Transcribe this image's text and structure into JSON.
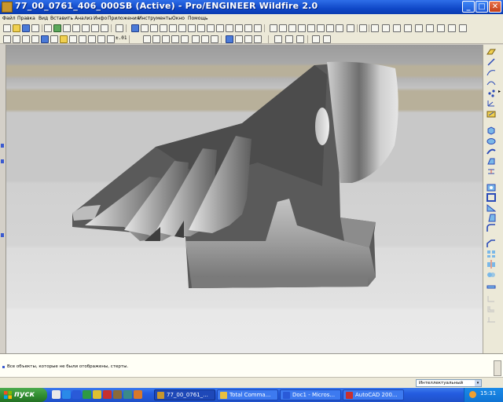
{
  "window": {
    "title": "77_00_0761_406_000SB (Active) - Pro/ENGINEER Wildfire 2.0",
    "minimize_glyph": "_",
    "maximize_glyph": "□",
    "close_glyph": "✕"
  },
  "menu": [
    "Файл",
    "Правка",
    "Вид",
    "Вставить",
    "Анализ",
    "Инфо",
    "Приложения",
    "Инструменты",
    "Окно",
    "Помощь"
  ],
  "toolbar": {
    "zoom_label": "±.01",
    "icons": [
      "new-icon",
      "open-icon",
      "save-icon",
      "print-icon",
      "regenerate-icon",
      "undo-icon",
      "redo-icon",
      "cut-icon",
      "copy-icon",
      "paste-icon",
      "zoom-in-icon",
      "zoom-out-icon",
      "refit-icon",
      "datum-planes-icon",
      "datum-axes-icon",
      "datum-points-icon",
      "coordinate-systems-icon",
      "wireframe-icon",
      "hidden-line-icon",
      "shading-icon"
    ]
  },
  "right_toolbar": {
    "icons": [
      "datum-plane-icon",
      "datum-axis-icon",
      "sketch-curve-icon",
      "datum-point-icon",
      "coordinate-system-icon",
      "sketch-icon",
      "extrude-icon",
      "revolve-icon",
      "sweep-icon",
      "blend-icon",
      "hole-icon",
      "round-icon",
      "chamfer-icon",
      "rib-icon",
      "shell-icon",
      "draft-icon",
      "pattern-icon",
      "mirror-icon",
      "merge-icon",
      "trim-icon"
    ],
    "more_glyph": "▸"
  },
  "message_area": {
    "message": "Все объекты, которые не были отображены, стерты."
  },
  "status_bar": {
    "selection_filter": "Интеллектуальный",
    "dropdown_glyph": "▾"
  },
  "taskbar": {
    "start_label": "пуск",
    "tasks": [
      {
        "label": "77_00_0761_...",
        "active": true,
        "icon_color": "#c7962e"
      },
      {
        "label": "Total Comma...",
        "active": false,
        "icon_color": "#e8c040"
      },
      {
        "label": "Doc1 - Micros...",
        "active": false,
        "icon_color": "#2a5ad8"
      },
      {
        "label": "AutoCAD 200...",
        "active": false,
        "icon_color": "#c83030"
      }
    ],
    "clock": "15:31"
  },
  "colors": {
    "titlebar": "#1048c8",
    "model_shade": "#5a5a5a",
    "viewport_band_tan": "#b8b09a",
    "taskbar": "#245ce0",
    "start_button": "#2e8a2e"
  }
}
